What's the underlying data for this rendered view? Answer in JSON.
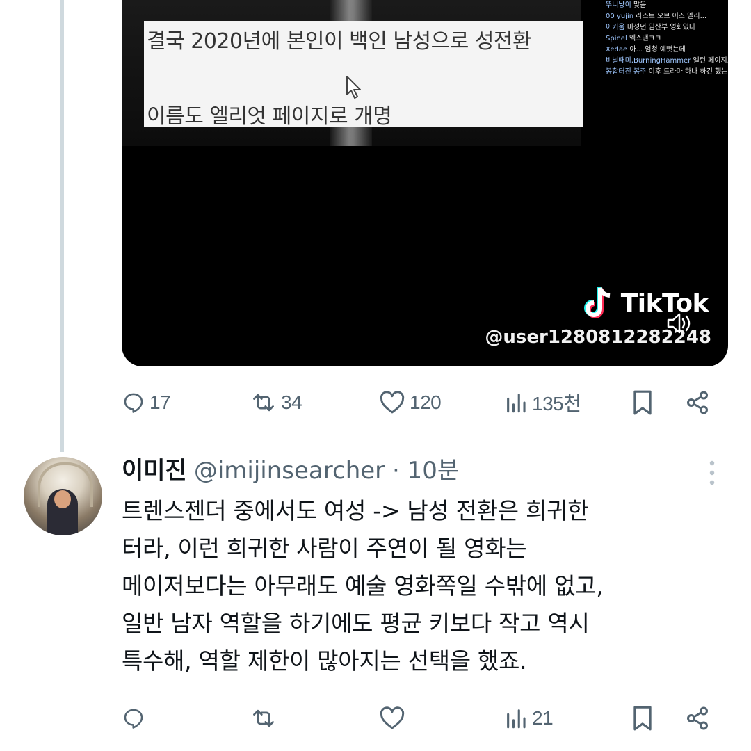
{
  "media": {
    "subtitle_line_1": "결국 2020년에 본인이 백인 남성으로 성전환",
    "subtitle_line_2": "이름도 엘리엇 페이지로 개명",
    "chat": [
      {
        "nick": "뚜니냥이",
        "text": "맞음"
      },
      {
        "nick": "00 yujin",
        "text": "라스트 오브 어스 엘리..."
      },
      {
        "nick": "이키움",
        "text": "미성년 임산부 영화였나"
      },
      {
        "nick": "Spinel",
        "text": "엑스맨ㅋㅋ"
      },
      {
        "nick": "Xedae",
        "text": "아... 엄청 예뻣는데"
      },
      {
        "nick": "비닐때미,BurningHammer",
        "text": "엘런 페이지...한때 시랑했었다ㅜㅜ"
      },
      {
        "nick": "봉합터진 봉주",
        "text": "이후 드라마 하나 하긴 했는데..."
      }
    ],
    "tiktok_brand": "TikTok",
    "tiktok_user": "@user1280812282248"
  },
  "post_actions": {
    "replies": "17",
    "reposts": "34",
    "likes": "120",
    "views": "135천"
  },
  "reply": {
    "name": "이미진",
    "meta": "@imijinsearcher · 10분",
    "text": "트렌스젠더 중에서도 여성 -> 남성 전환은  희귀한\n터라, 이런 희귀한 사람이 주연이 될 영화는\n메이저보다는 아무래도 예술 영화쪽일 수밖에 없고,\n일반 남자 역할을 하기에도 평균 키보다 작고 역시\n특수해, 역할 제한이 많아지는 선택을 했죠.",
    "actions": {
      "replies": "",
      "reposts": "",
      "likes": "",
      "views": "21"
    }
  },
  "colors": {
    "icon_gray": "#536471",
    "thread_line": "#cfd9de",
    "text": "#0f1419"
  }
}
